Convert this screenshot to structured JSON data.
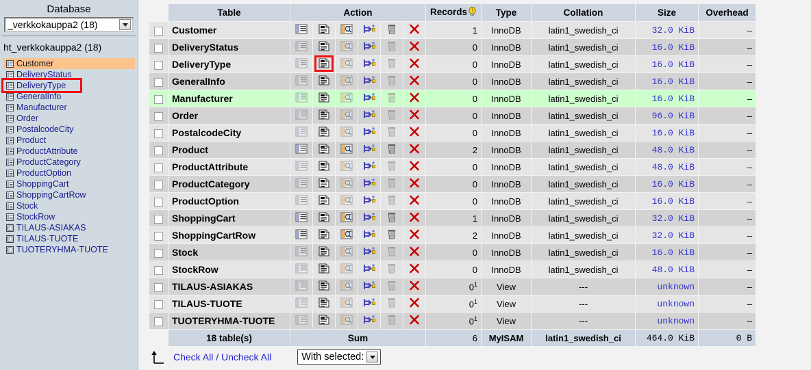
{
  "sidebar": {
    "heading": "Database",
    "db_select_value": "_verkkokauppa2 (18)",
    "db_name": "ht_verkkokauppa2 (18)",
    "active_table": "Customer",
    "highlighted_table": "DeliveryType",
    "items": [
      {
        "label": "Customer",
        "icon": "table-icon"
      },
      {
        "label": "DeliveryStatus",
        "icon": "table-icon"
      },
      {
        "label": "DeliveryType",
        "icon": "table-icon"
      },
      {
        "label": "GeneralInfo",
        "icon": "table-icon"
      },
      {
        "label": "Manufacturer",
        "icon": "table-icon"
      },
      {
        "label": "Order",
        "icon": "table-icon"
      },
      {
        "label": "PostalcodeCity",
        "icon": "table-icon"
      },
      {
        "label": "Product",
        "icon": "table-icon"
      },
      {
        "label": "ProductAttribute",
        "icon": "table-icon"
      },
      {
        "label": "ProductCategory",
        "icon": "table-icon"
      },
      {
        "label": "ProductOption",
        "icon": "table-icon"
      },
      {
        "label": "ShoppingCart",
        "icon": "table-icon"
      },
      {
        "label": "ShoppingCartRow",
        "icon": "table-icon"
      },
      {
        "label": "Stock",
        "icon": "table-icon"
      },
      {
        "label": "StockRow",
        "icon": "table-icon"
      },
      {
        "label": "TILAUS-ASIAKAS",
        "icon": "view-icon"
      },
      {
        "label": "TILAUS-TUOTE",
        "icon": "view-icon"
      },
      {
        "label": "TUOTERYHMA-TUOTE",
        "icon": "view-icon"
      }
    ]
  },
  "main": {
    "headers": {
      "table": "Table",
      "action": "Action",
      "records": "Records",
      "records_help_icon": "lightbulb-icon",
      "type": "Type",
      "collation": "Collation",
      "size": "Size",
      "overhead": "Overhead"
    },
    "action_icons": [
      "browse-icon",
      "structure-icon",
      "search-icon",
      "insert-icon",
      "empty-icon",
      "drop-icon"
    ],
    "rows": [
      {
        "name": "Customer",
        "records": "1",
        "type": "InnoDB",
        "collation": "latin1_swedish_ci",
        "size": "32.0 KiB",
        "overhead": "–",
        "dim": false,
        "hover": false,
        "is_view": false
      },
      {
        "name": "DeliveryStatus",
        "records": "0",
        "type": "InnoDB",
        "collation": "latin1_swedish_ci",
        "size": "16.0 KiB",
        "overhead": "–",
        "dim": true,
        "hover": false,
        "is_view": false
      },
      {
        "name": "DeliveryType",
        "records": "0",
        "type": "InnoDB",
        "collation": "latin1_swedish_ci",
        "size": "16.0 KiB",
        "overhead": "–",
        "dim": true,
        "hover": false,
        "is_view": false
      },
      {
        "name": "GeneralInfo",
        "records": "0",
        "type": "InnoDB",
        "collation": "latin1_swedish_ci",
        "size": "16.0 KiB",
        "overhead": "–",
        "dim": true,
        "hover": false,
        "is_view": false
      },
      {
        "name": "Manufacturer",
        "records": "0",
        "type": "InnoDB",
        "collation": "latin1_swedish_ci",
        "size": "16.0 KiB",
        "overhead": "–",
        "dim": true,
        "hover": true,
        "is_view": false
      },
      {
        "name": "Order",
        "records": "0",
        "type": "InnoDB",
        "collation": "latin1_swedish_ci",
        "size": "96.0 KiB",
        "overhead": "–",
        "dim": true,
        "hover": false,
        "is_view": false
      },
      {
        "name": "PostalcodeCity",
        "records": "0",
        "type": "InnoDB",
        "collation": "latin1_swedish_ci",
        "size": "16.0 KiB",
        "overhead": "–",
        "dim": true,
        "hover": false,
        "is_view": false
      },
      {
        "name": "Product",
        "records": "2",
        "type": "InnoDB",
        "collation": "latin1_swedish_ci",
        "size": "48.0 KiB",
        "overhead": "–",
        "dim": false,
        "hover": false,
        "is_view": false
      },
      {
        "name": "ProductAttribute",
        "records": "0",
        "type": "InnoDB",
        "collation": "latin1_swedish_ci",
        "size": "48.0 KiB",
        "overhead": "–",
        "dim": true,
        "hover": false,
        "is_view": false
      },
      {
        "name": "ProductCategory",
        "records": "0",
        "type": "InnoDB",
        "collation": "latin1_swedish_ci",
        "size": "16.0 KiB",
        "overhead": "–",
        "dim": true,
        "hover": false,
        "is_view": false
      },
      {
        "name": "ProductOption",
        "records": "0",
        "type": "InnoDB",
        "collation": "latin1_swedish_ci",
        "size": "16.0 KiB",
        "overhead": "–",
        "dim": true,
        "hover": false,
        "is_view": false
      },
      {
        "name": "ShoppingCart",
        "records": "1",
        "type": "InnoDB",
        "collation": "latin1_swedish_ci",
        "size": "32.0 KiB",
        "overhead": "–",
        "dim": false,
        "hover": false,
        "is_view": false
      },
      {
        "name": "ShoppingCartRow",
        "records": "2",
        "type": "InnoDB",
        "collation": "latin1_swedish_ci",
        "size": "32.0 KiB",
        "overhead": "–",
        "dim": false,
        "hover": false,
        "is_view": false
      },
      {
        "name": "Stock",
        "records": "0",
        "type": "InnoDB",
        "collation": "latin1_swedish_ci",
        "size": "16.0 KiB",
        "overhead": "–",
        "dim": true,
        "hover": false,
        "is_view": false
      },
      {
        "name": "StockRow",
        "records": "0",
        "type": "InnoDB",
        "collation": "latin1_swedish_ci",
        "size": "48.0 KiB",
        "overhead": "–",
        "dim": true,
        "hover": false,
        "is_view": false
      },
      {
        "name": "TILAUS-ASIAKAS",
        "records": "0",
        "records_sup": "1",
        "type": "View",
        "collation": "---",
        "size": "unknown",
        "overhead": "–",
        "dim": true,
        "hover": false,
        "is_view": true
      },
      {
        "name": "TILAUS-TUOTE",
        "records": "0",
        "records_sup": "1",
        "type": "View",
        "collation": "---",
        "size": "unknown",
        "overhead": "–",
        "dim": true,
        "hover": false,
        "is_view": true
      },
      {
        "name": "TUOTERYHMA-TUOTE",
        "records": "0",
        "records_sup": "1",
        "type": "View",
        "collation": "---",
        "size": "unknown",
        "overhead": "–",
        "dim": true,
        "hover": false,
        "is_view": true
      }
    ],
    "summary": {
      "tables_count": "18 table(s)",
      "sum_label": "Sum",
      "records": "6",
      "type": "MyISAM",
      "collation": "latin1_swedish_ci",
      "size": "464.0 KiB",
      "overhead": "0 B"
    },
    "footer": {
      "arrow_icon": "arrow-up-left-icon",
      "check_all": "Check All",
      "separator": "/",
      "uncheck_all": "Uncheck All",
      "with_selected_label": "With selected:",
      "with_selected_icon": "chevron-down-icon"
    }
  },
  "colors": {
    "header_bg": "#ccd5e0",
    "row_odd": "#e5e5e5",
    "row_even": "#d3d3d3",
    "row_hover": "#cdffcd",
    "sidebar_bg": "#d0dae0",
    "sidebar_active": "#fcc28c",
    "highlight_box": "#ee1111",
    "link": "#2222cc",
    "size_text": "#3333cc"
  }
}
